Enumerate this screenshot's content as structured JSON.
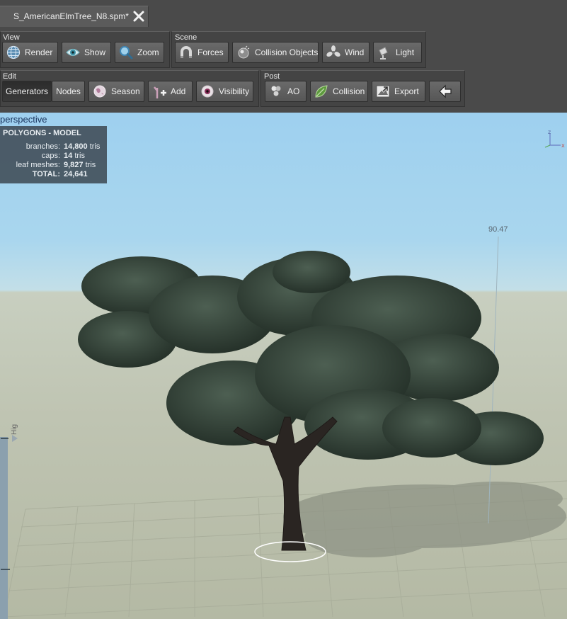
{
  "tab": {
    "title": "S_AmericanElmTree_N8.spm*",
    "close_icon": "close-icon"
  },
  "groups": {
    "view": "View",
    "scene": "Scene",
    "edit": "Edit",
    "post": "Post"
  },
  "buttons": {
    "render": "Render",
    "show": "Show",
    "zoom": "Zoom",
    "forces": "Forces",
    "collision_objects": "Collision Objects",
    "wind": "Wind",
    "light": "Light",
    "generators": "Generators",
    "nodes": "Nodes",
    "season": "Season",
    "add": "Add",
    "visibility": "Visibility",
    "ao": "AO",
    "collision": "Collision",
    "export": "Export"
  },
  "viewport": {
    "label": "perspective",
    "height_readout": "90.47",
    "side_label": "Hig",
    "axis": {
      "z": "z",
      "x": "x"
    }
  },
  "polygons": {
    "title": "POLYGONS - MODEL",
    "rows": [
      {
        "label": "branches:",
        "value": "14,800",
        "unit": "tris"
      },
      {
        "label": "caps:",
        "value": "14",
        "unit": "tris"
      },
      {
        "label": "leaf meshes:",
        "value": "9,827",
        "unit": "tris"
      },
      {
        "label": "TOTAL:",
        "value": "24,641",
        "unit": ""
      }
    ]
  },
  "colors": {
    "toolbar_bg": "#4a4a4a",
    "sky": "#a9d6ee",
    "ground": "#bfc4b2",
    "foliage": "#2f3d33",
    "trunk": "#2a2522"
  }
}
